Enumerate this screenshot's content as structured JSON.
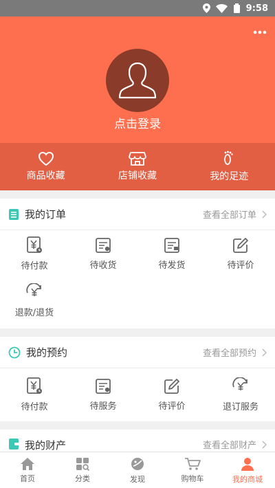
{
  "status_bar": {
    "time": "9:58",
    "icons": [
      "location-icon",
      "wifi-icon",
      "signal-icon"
    ]
  },
  "header": {
    "login_text": "点击登录",
    "more_icon": "more-dots-icon",
    "avatar_icon": "user-silhouette-icon"
  },
  "favorites": [
    {
      "label": "商品收藏",
      "icon": "heart-icon"
    },
    {
      "label": "店铺收藏",
      "icon": "store-icon"
    },
    {
      "label": "我的足迹",
      "icon": "footprint-icon"
    }
  ],
  "orders": {
    "title": "我的订单",
    "view_all": "查看全部订单",
    "items": [
      {
        "label": "待付款",
        "icon": "yen-clock-icon"
      },
      {
        "label": "待收货",
        "icon": "receive-box-icon"
      },
      {
        "label": "待发货",
        "icon": "ship-box-icon"
      },
      {
        "label": "待评价",
        "icon": "edit-icon"
      },
      {
        "label": "退款/退货",
        "icon": "refund-icon"
      }
    ]
  },
  "booking": {
    "title": "我的预约",
    "view_all": "查看全部预约",
    "items": [
      {
        "label": "待付款",
        "icon": "yen-clock-icon"
      },
      {
        "label": "待服务",
        "icon": "service-icon"
      },
      {
        "label": "待评价",
        "icon": "edit-icon"
      },
      {
        "label": "退订服务",
        "icon": "refund-icon"
      }
    ]
  },
  "assets": {
    "title": "我的财产",
    "view_all": "查看全部财产"
  },
  "tabbar": [
    {
      "label": "首页",
      "icon": "home-icon"
    },
    {
      "label": "分类",
      "icon": "category-icon"
    },
    {
      "label": "发现",
      "icon": "discover-icon"
    },
    {
      "label": "购物车",
      "icon": "cart-icon"
    },
    {
      "label": "我的商城",
      "icon": "profile-icon",
      "active": true
    }
  ],
  "colors": {
    "brand": "#fd6f4f",
    "brand_dark": "#e25f44",
    "avatar_bg": "#8b3b2a",
    "section_icon_green": "#3cc8b4",
    "status_bar": "#7a7a7a"
  }
}
